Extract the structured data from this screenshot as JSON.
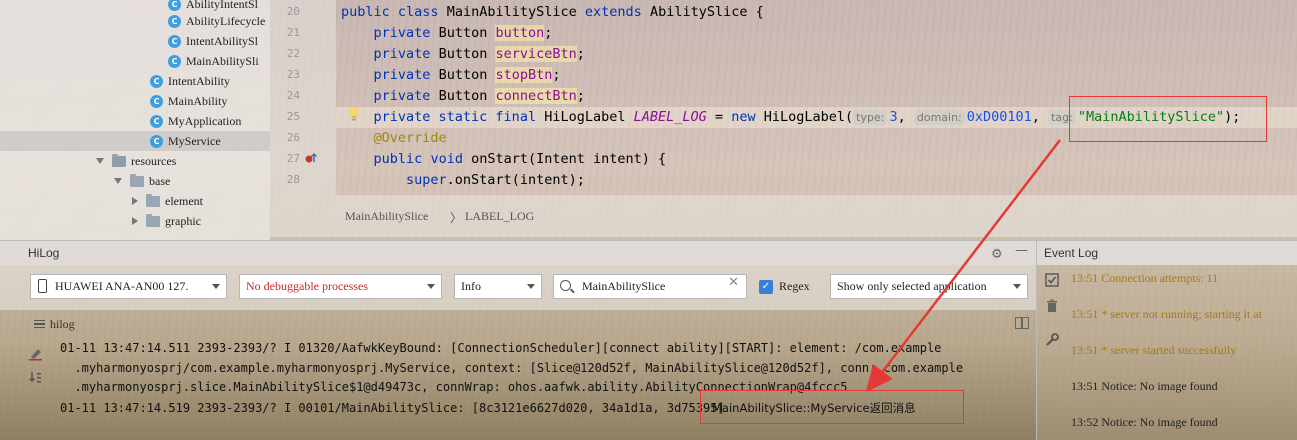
{
  "project_tree": {
    "items": [
      {
        "label": "AbilityIntentSl",
        "kind": "class"
      },
      {
        "label": "AbilityLifecycle",
        "kind": "class"
      },
      {
        "label": "IntentAbilitySl",
        "kind": "class"
      },
      {
        "label": "MainAbilitySli",
        "kind": "class"
      },
      {
        "label": "IntentAbility",
        "kind": "class"
      },
      {
        "label": "MainAbility",
        "kind": "class"
      },
      {
        "label": "MyApplication",
        "kind": "class"
      },
      {
        "label": "MyService",
        "kind": "class",
        "selected": true
      },
      {
        "label": "resources",
        "kind": "folder-expanded"
      },
      {
        "label": "base",
        "kind": "folder-expanded"
      },
      {
        "label": "element",
        "kind": "folder-collapsed"
      },
      {
        "label": "graphic",
        "kind": "folder-collapsed"
      }
    ]
  },
  "editor": {
    "line_numbers": [
      "20",
      "21",
      "22",
      "23",
      "24",
      "25",
      "26",
      "27",
      "28"
    ],
    "line20": {
      "kw1": "public",
      "kw2": "class",
      "name": "MainAbilitySlice",
      "kw3": "extends",
      "parent": "AbilitySlice {"
    },
    "line21": {
      "mod": "private",
      "type": "Button",
      "field": "button",
      "end": ";"
    },
    "line22": {
      "mod": "private",
      "type": "Button",
      "field": "serviceBtn",
      "end": ";"
    },
    "line23": {
      "mod": "private",
      "type": "Button",
      "field": "stopBtn",
      "end": ";"
    },
    "line24": {
      "mod": "private",
      "type": "Button",
      "field": "connectBtn",
      "end": ";"
    },
    "line25": {
      "mods": "private static final",
      "type": "HiLogLabel",
      "const": "LABEL_LOG",
      "eq": "=",
      "kw_new": "new",
      "ctor": "HiLogLabel(",
      "hint_type": "type:",
      "arg_type": "3",
      "comma1": ",",
      "hint_domain": "domain:",
      "arg_domain": "0xD00101",
      "comma2": ",",
      "hint_tag": "tag:",
      "arg_tag": "\"MainAbilitySlice\"",
      "end": ");"
    },
    "line26": {
      "annotation": "@Override"
    },
    "line27": {
      "mod": "public",
      "kw_void": "void",
      "method": "onStart(Intent intent) {"
    },
    "line28": {
      "kw_super": "super",
      "call": ".onStart(intent);"
    }
  },
  "breadcrumb": {
    "items": [
      "MainAbilitySlice",
      "LABEL_LOG"
    ],
    "separator": "〉"
  },
  "hilog": {
    "title": "HiLog",
    "device": "HUAWEI ANA-AN00 127.",
    "process": "No debuggable processes",
    "level": "Info",
    "search_value": "MainAbilitySlice",
    "regex_label": "Regex",
    "regex_checked": true,
    "filter": "Show only selected application",
    "tab_label": "hilog",
    "log_lines": [
      "01-11 13:47:14.511 2393-2393/? I 01320/AafwkKeyBound: [ConnectionScheduler][connect ability][START]: element: /com.example",
      "  .myharmonyosprj/com.example.myharmonyosprj.MyService, context: [Slice@120d52f, MainAbilitySlice@120d52f], conn: com.example",
      "  .myharmonyosprj.slice.MainAbilitySlice$1@d49473c, connWrap: ohos.aafwk.ability.AbilityConnectionWrap@4fccc5",
      "01-11 13:47:14.519 2393-2393/? I 00101/MainAbilitySlice: [8c3121e6627d020, 34a1d1a, 3d75395] ",
      "MainAbilitySlice::MyService返回消息"
    ]
  },
  "event_log": {
    "title": "Event Log",
    "entries": [
      {
        "time": "13:51",
        "text": "Connection attempts: 11",
        "level": "warn"
      },
      {
        "time": "13:51",
        "text": "* server not running; starting it at",
        "level": "warn"
      },
      {
        "time": "13:51",
        "text": "* server started successfully",
        "level": "warn"
      },
      {
        "time": "13:51",
        "text": "Notice: No image found",
        "level": "info"
      },
      {
        "time": "13:52",
        "text": "Notice: No image found",
        "level": "info"
      }
    ]
  },
  "colors": {
    "annotation_red": "#e53935",
    "keyword": "#0033b3",
    "field": "#871094",
    "string": "#067d17",
    "warn": "#a4791a"
  }
}
